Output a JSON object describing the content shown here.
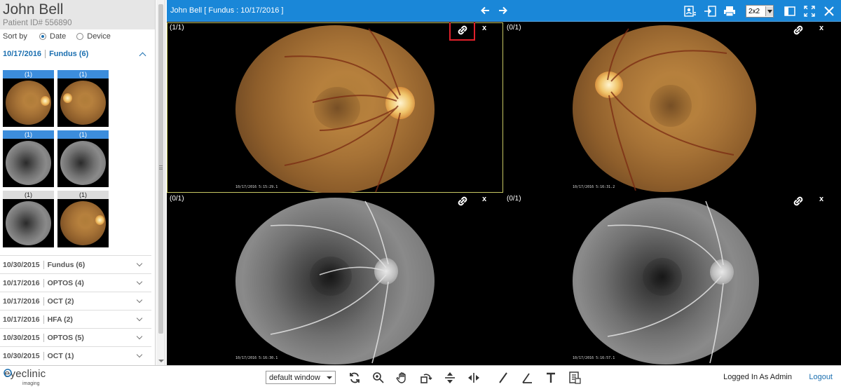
{
  "patient": {
    "name": "John Bell",
    "id": "Patient ID# 556890"
  },
  "sort": {
    "label": "Sort by",
    "options": [
      "Date",
      "Device"
    ],
    "selected": "Date"
  },
  "open_group": {
    "date": "10/17/2016",
    "label": "Fundus (6)"
  },
  "thumbnails": [
    {
      "label": "(1)",
      "kind": "color",
      "selected": true
    },
    {
      "label": "(1)",
      "kind": "color",
      "selected": true
    },
    {
      "label": "(1)",
      "kind": "fa",
      "selected": true
    },
    {
      "label": "(1)",
      "kind": "fa",
      "selected": true
    },
    {
      "label": "(1)",
      "kind": "fa",
      "selected": false
    },
    {
      "label": "(1)",
      "kind": "color",
      "selected": false
    }
  ],
  "groups": [
    {
      "date": "10/30/2015",
      "label": "Fundus (6)"
    },
    {
      "date": "10/17/2016",
      "label": "OPTOS (4)"
    },
    {
      "date": "10/17/2016",
      "label": "OCT (2)"
    },
    {
      "date": "10/17/2016",
      "label": "HFA (2)"
    },
    {
      "date": "10/30/2015",
      "label": "OPTOS (5)"
    },
    {
      "date": "10/30/2015",
      "label": "OCT (1)"
    }
  ],
  "viewer": {
    "title": "John Bell [ Fundus : 10/17/2016 ]",
    "layout": "2x2",
    "panes": [
      {
        "counter": "(1/1)",
        "kind": "color",
        "stamp": "10/17/2016 5:15:29.1",
        "link_highlighted": true
      },
      {
        "counter": "(0/1)",
        "kind": "color",
        "stamp": "10/17/2016 5:16:31.2",
        "link_highlighted": false
      },
      {
        "counter": "(0/1)",
        "kind": "fa",
        "stamp": "10/17/2016 5:16:30.1",
        "link_highlighted": false
      },
      {
        "counter": "(0/1)",
        "kind": "fa",
        "stamp": "10/17/2016 5:16:57.1",
        "link_highlighted": false
      }
    ],
    "close_label": "x"
  },
  "bottom": {
    "brand": "eyeclinic",
    "brand_sub": "imaging",
    "window_preset": "default window",
    "login_text": "Logged In As Admin",
    "logout_label": "Logout"
  },
  "colors": {
    "accent": "#1a87d8",
    "link_blue": "#1b6fb0",
    "highlight": "#e0202a"
  }
}
